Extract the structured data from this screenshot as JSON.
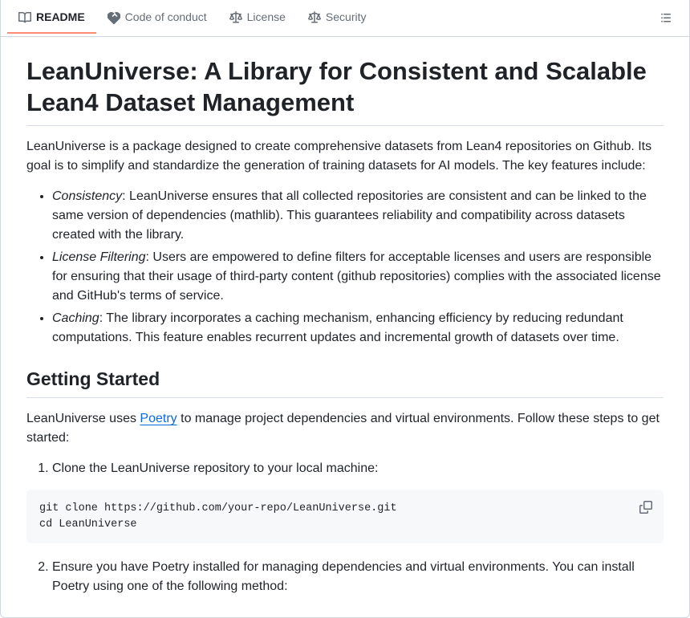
{
  "tabs": {
    "readme": "README",
    "coc": "Code of conduct",
    "license": "License",
    "security": "Security"
  },
  "title": "LeanUniverse: A Library for Consistent and Scalable Lean4 Dataset Management",
  "intro": "LeanUniverse is a package designed to create comprehensive datasets from Lean4 repositories on Github. Its goal is to simplify and standardize the generation of training datasets for AI models. The key features include:",
  "features": [
    {
      "label": "Consistency",
      "body": ": LeanUniverse ensures that all collected repositories are consistent and can be linked to the same version of dependencies (mathlib). This guarantees reliability and compatibility across datasets created with the library."
    },
    {
      "label": "License Filtering",
      "body": ": Users are empowered to define filters for acceptable licenses and users are responsible for ensuring that their usage of third-party content (github repositories) complies with the associated license and GitHub's terms of service."
    },
    {
      "label": "Caching",
      "body": ": The library incorporates a caching mechanism, enhancing efficiency by reducing redundant computations. This feature enables recurrent updates and incremental growth of datasets over time."
    }
  ],
  "getting_started_heading": "Getting Started",
  "gs_intro_pre": "LeanUniverse uses ",
  "gs_intro_link": "Poetry",
  "gs_intro_post": " to manage project dependencies and virtual environments. Follow these steps to get started:",
  "step1": "Clone the LeanUniverse repository to your local machine:",
  "code1": "git clone https://github.com/your-repo/LeanUniverse.git\ncd LeanUniverse",
  "step2": "Ensure you have Poetry installed for managing dependencies and virtual environments. You can install Poetry using one of the following method:"
}
